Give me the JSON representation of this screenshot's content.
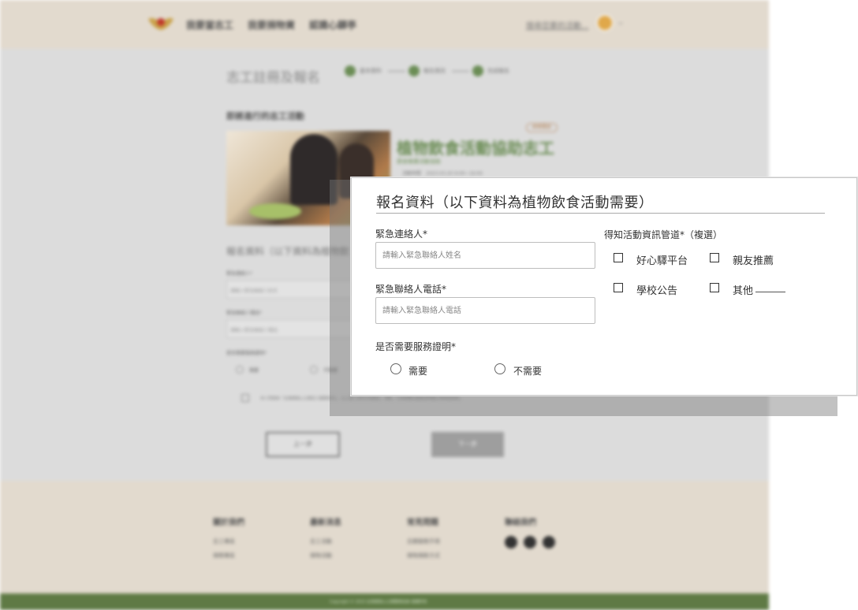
{
  "background": {
    "nav": [
      "我要當志工",
      "我要捐物資",
      "認識心驛亭"
    ],
    "search_text": "搜尋您要的活動...",
    "page_title": "志工註冊及報名",
    "steps": [
      "基本資料",
      "報名資訊",
      "完成報名"
    ],
    "section_title": "即將進行的志工活動",
    "event_badge": "即將開放",
    "event_title": "植物飲食活動協助志工",
    "event_subtitle": "蔬食推廣活動協助",
    "event_time": "活動時間　2023.03.20 9:00~16:00",
    "form_title": "報名資料（以下資料為植物飲",
    "field1_label": "緊急連絡人*",
    "field1_placeholder": "請輸入緊急聯絡人姓名",
    "field2_label": "緊急聯絡人電話*",
    "field2_placeholder": "請輸入緊急聯絡人電話",
    "field3_label": "是否需要服務證明*",
    "radio1": "需要",
    "radio2": "不需要",
    "agree_text": "本人同意依「台灣環境心之驛志工服務辦法」，以上個人資料作為報名、保險、行政聯繫及服務證明開立等用途使用。",
    "prev_button": "上一步",
    "next_button": "下一步",
    "footer_cols": [
      {
        "head": "關於我們",
        "links": [
          "志工專區",
          "捐贈專區"
        ]
      },
      {
        "head": "最新消息",
        "links": [
          "志工活動",
          "捐物活動"
        ]
      },
      {
        "head": "常見問題",
        "links": [
          "志願服務手冊",
          "捐物捐款方式"
        ]
      },
      {
        "head": "聯絡我們",
        "links": []
      }
    ],
    "copyright": "Copyright © 2023 台灣環境心之驛關懷協會 版權所有"
  },
  "card": {
    "title": "報名資料（以下資料為植物飲食活動需要）",
    "emergency_contact_label": "緊急連絡人*",
    "emergency_contact_placeholder": "請輸入緊急聯絡人姓名",
    "emergency_phone_label": "緊急聯絡人電話*",
    "emergency_phone_placeholder": "請輸入緊急聯絡人電話",
    "service_cert_label": "是否需要服務證明*",
    "radio_need": "需要",
    "radio_no_need": "不需要",
    "source_label": "得知活動資訊管道*（複選）",
    "source_options": [
      "好心驛平台",
      "親友推薦",
      "學校公告",
      "其他"
    ]
  },
  "colors": {
    "accent_green": "#6b8d55",
    "header_beige": "#e2dace",
    "footer_green": "#5f7a45"
  }
}
